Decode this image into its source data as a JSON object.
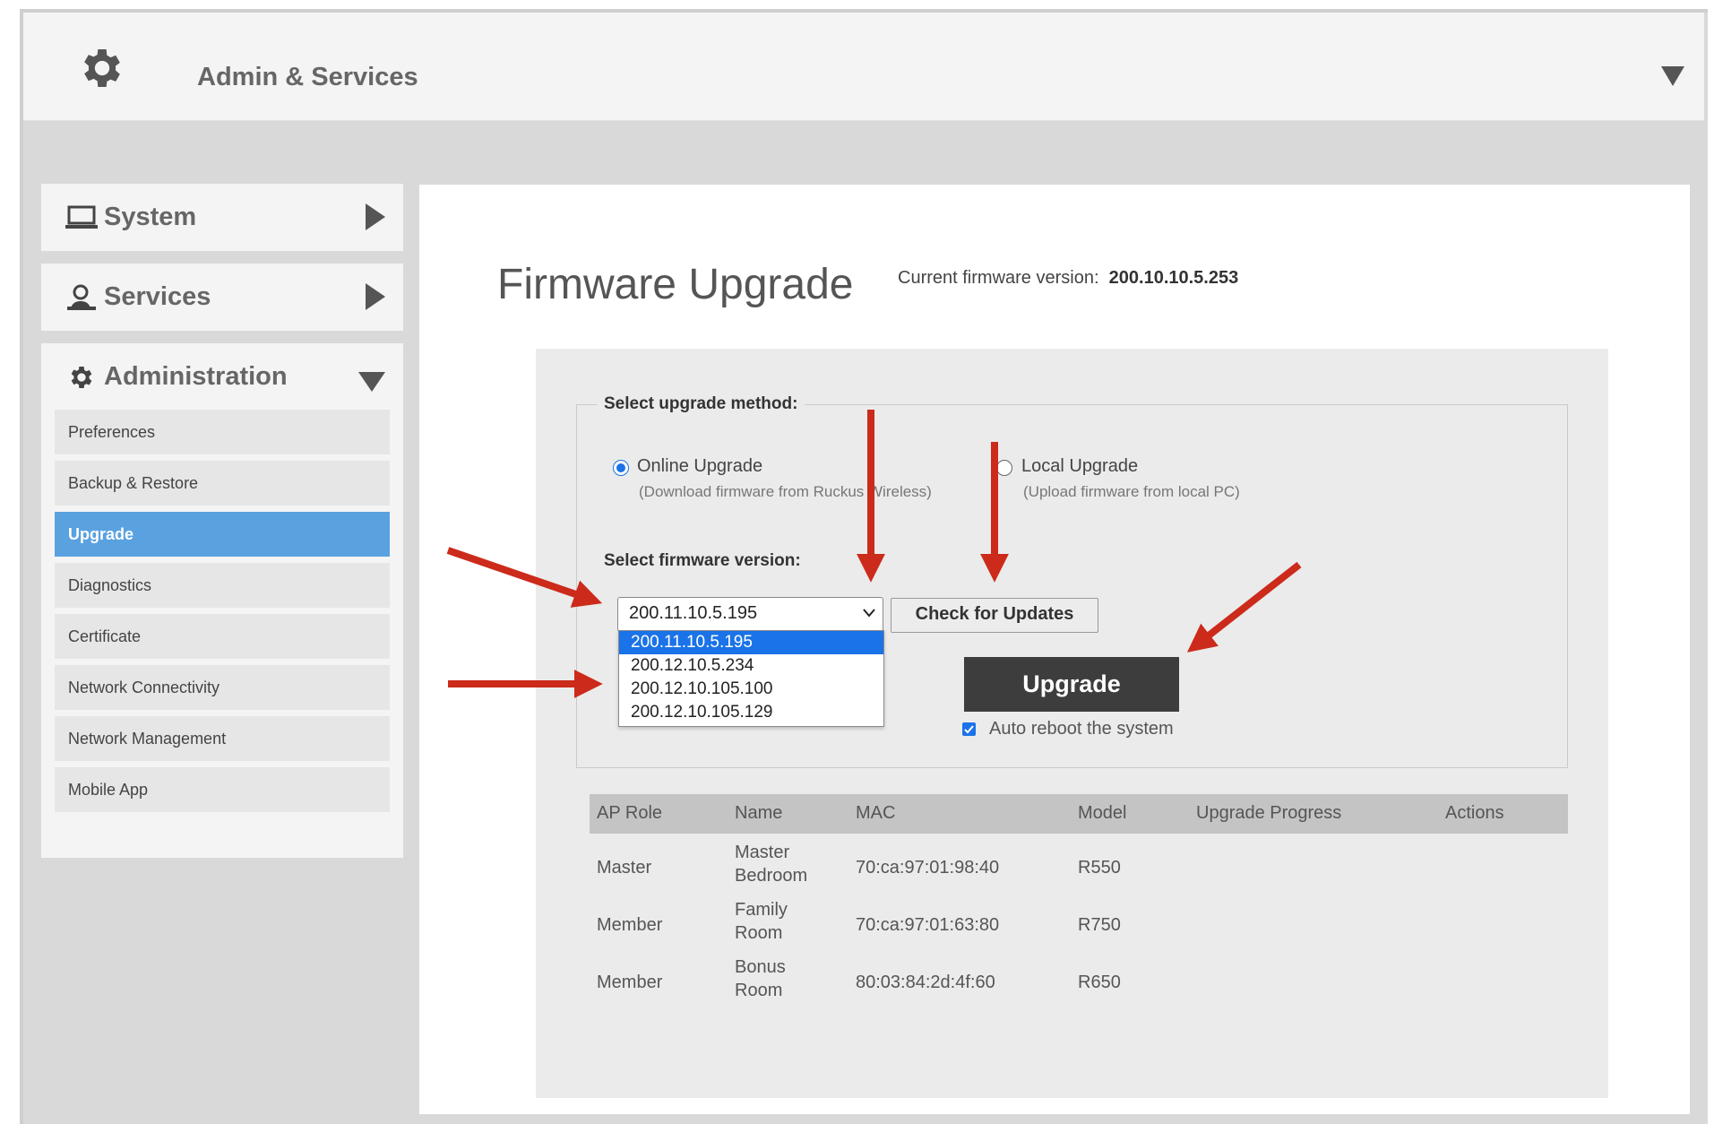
{
  "header": {
    "title": "Admin & Services",
    "icon": "gear-icon"
  },
  "sidebar": {
    "system": {
      "label": "System",
      "icon": "laptop-icon"
    },
    "services": {
      "label": "Services",
      "icon": "services-icon"
    },
    "administration": {
      "label": "Administration",
      "icon": "gear-icon",
      "items": [
        {
          "label": "Preferences"
        },
        {
          "label": "Backup & Restore"
        },
        {
          "label": "Upgrade",
          "active": true
        },
        {
          "label": "Diagnostics"
        },
        {
          "label": "Certificate"
        },
        {
          "label": "Network Connectivity"
        },
        {
          "label": "Network Management"
        },
        {
          "label": "Mobile App"
        }
      ]
    }
  },
  "main": {
    "title": "Firmware Upgrade",
    "current_version_label": "Current firmware version:",
    "current_version": "200.10.10.5.253",
    "method_legend": "Select upgrade method:",
    "online": {
      "label": "Online Upgrade",
      "sub": "(Download firmware from Ruckus Wireless)",
      "selected": true
    },
    "local": {
      "label": "Local Upgrade",
      "sub": "(Upload firmware from local PC)",
      "selected": false
    },
    "version_label": "Select firmware version:",
    "selected_version": "200.11.10.5.195",
    "version_options": [
      "200.11.10.5.195",
      "200.12.10.5.234",
      "200.12.10.105.100",
      "200.12.10.105.129"
    ],
    "check_button": "Check for Updates",
    "upgrade_button": "Upgrade",
    "auto_reboot_label": "Auto reboot the system",
    "auto_reboot_checked": true
  },
  "table": {
    "columns": [
      "AP Role",
      "Name",
      "MAC",
      "Model",
      "Upgrade Progress",
      "Actions"
    ],
    "rows": [
      {
        "role": "Master",
        "name_1": "Master",
        "name_2": "Bedroom",
        "mac": "70:ca:97:01:98:40",
        "model": "R550"
      },
      {
        "role": "Member",
        "name_1": "Family",
        "name_2": "Room",
        "mac": "70:ca:97:01:63:80",
        "model": "R750"
      },
      {
        "role": "Member",
        "name_1": "Bonus",
        "name_2": "Room",
        "mac": "80:03:84:2d:4f:60",
        "model": "R650"
      }
    ]
  },
  "colors": {
    "accent": "#5aa1e0",
    "annotation_arrow": "#cc2a1a",
    "upgrade_button": "#3d3d3d"
  }
}
